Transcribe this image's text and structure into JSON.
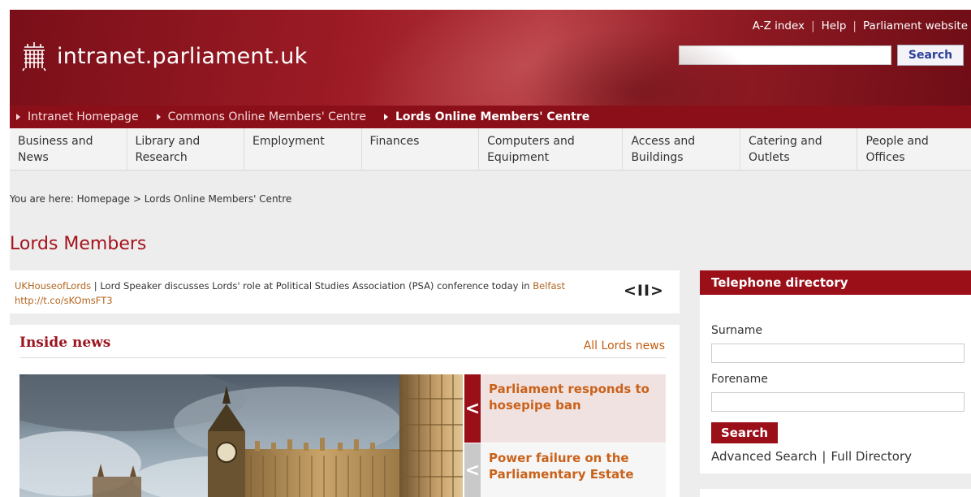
{
  "header": {
    "site_title": "intranet.parliament.uk",
    "top_links": [
      "A-Z index",
      "Help",
      "Parliament website"
    ],
    "search_button": "Search"
  },
  "subnav": [
    {
      "label": "Intranet Homepage",
      "active": false
    },
    {
      "label": "Commons Online Members' Centre",
      "active": false
    },
    {
      "label": "Lords Online Members' Centre",
      "active": true
    }
  ],
  "mainnav": [
    {
      "line1": "Business and",
      "line2": "News"
    },
    {
      "line1": "Library and",
      "line2": "Research"
    },
    {
      "line1": "Employment",
      "line2": ""
    },
    {
      "line1": "Finances",
      "line2": ""
    },
    {
      "line1": "Computers and",
      "line2": "Equipment"
    },
    {
      "line1": "Access and",
      "line2": "Buildings"
    },
    {
      "line1": "Catering and",
      "line2": "Outlets"
    },
    {
      "line1": "People and",
      "line2": "Offices"
    }
  ],
  "breadcrumb": "You are here: Homepage > Lords Online Members' Centre",
  "page_title": "Lords Members",
  "tweet": {
    "handle": "UKHouseofLords",
    "text_1": " | Lord Speaker discusses Lords' role at Political Studies Association (PSA) conference today in ",
    "place": "Belfast",
    "link": "http://t.co/sKOmsFT3",
    "controls": "<II>"
  },
  "news": {
    "title": "Inside news",
    "all_link": "All Lords news",
    "stories": [
      {
        "title": "Parliament responds to hosepipe ban",
        "arrow": "<"
      },
      {
        "title": "Power failure on the Parliamentary Estate",
        "arrow": "<"
      }
    ]
  },
  "telephone": {
    "title": "Telephone directory",
    "surname_label": "Surname",
    "forename_label": "Forename",
    "search_button": "Search",
    "advanced_link": "Advanced Search",
    "separator": "|",
    "full_link": "Full Directory"
  },
  "colors": {
    "brand_red": "#9b0f19",
    "link_orange": "#c9621a",
    "search_blue": "#2b3f9a"
  }
}
